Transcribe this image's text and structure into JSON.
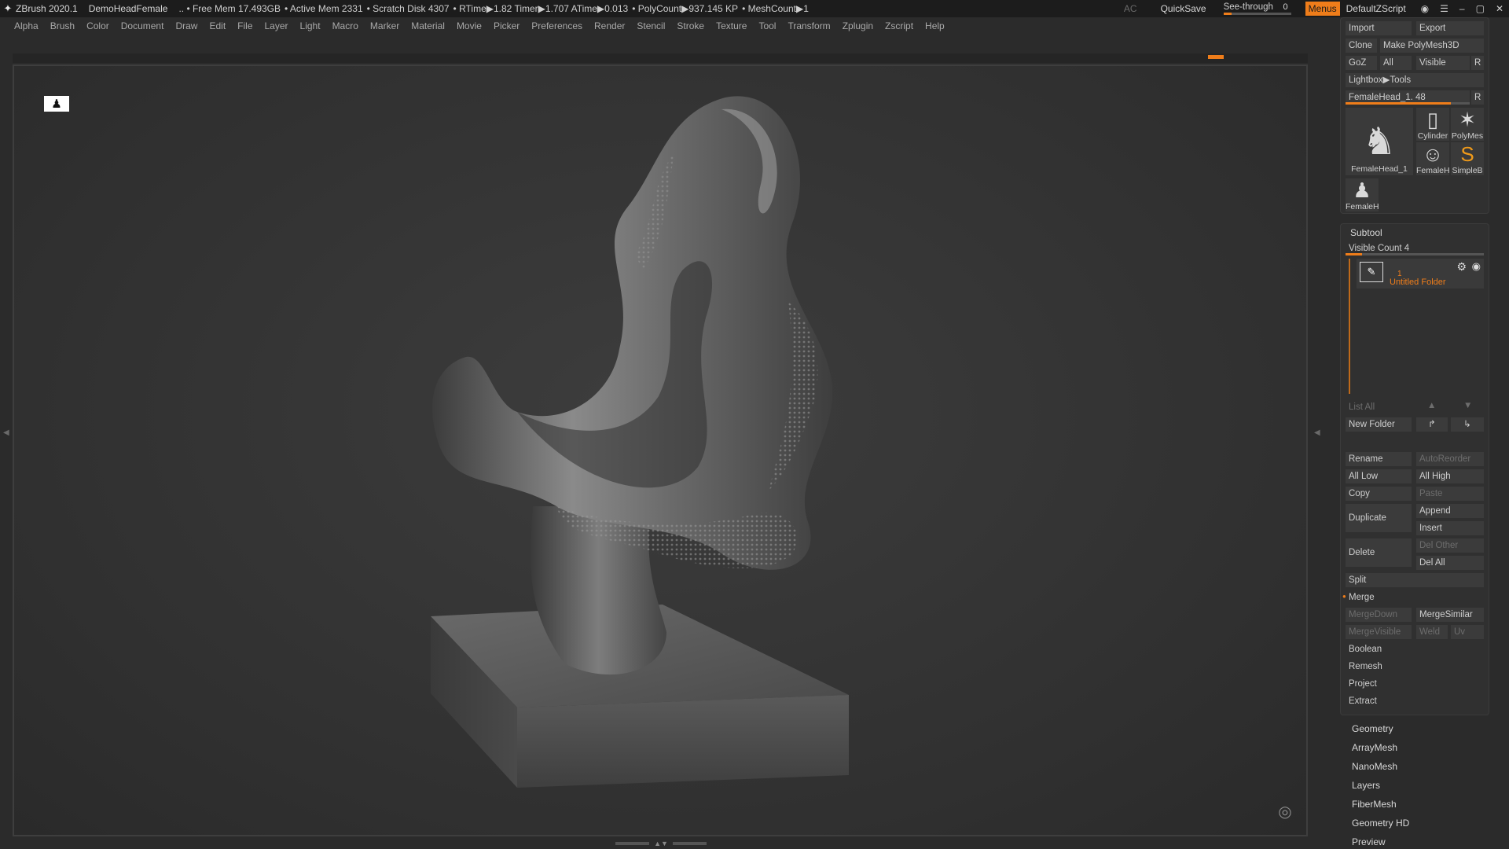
{
  "titlebar": {
    "app": "ZBrush 2020.1",
    "doc": "DemoHeadFemale",
    "stats": [
      ".. • Free Mem 17.493GB",
      "• Active Mem 2331",
      "• Scratch Disk 4307",
      "• RTime▶1.82 Timer▶1.707 ATime▶0.013",
      "• PolyCount▶937.145 KP",
      "• MeshCount▶1"
    ],
    "ac": "AC",
    "quicksave": "QuickSave",
    "see_through_label": "See-through",
    "see_through_value": "0",
    "see_through_fraction": 0.12,
    "menus": "Menus",
    "default_script": "DefaultZScript"
  },
  "menubar": [
    "Alpha",
    "Brush",
    "Color",
    "Document",
    "Draw",
    "Edit",
    "File",
    "Layer",
    "Light",
    "Macro",
    "Marker",
    "Material",
    "Movie",
    "Picker",
    "Preferences",
    "Render",
    "Stencil",
    "Stroke",
    "Texture",
    "Tool",
    "Transform",
    "Zplugin",
    "Zscript",
    "Help"
  ],
  "tool": {
    "import": "Import",
    "export": "Export",
    "clone": "Clone",
    "make_polymesh": "Make PolyMesh3D",
    "goz": "GoZ",
    "all": "All",
    "visible": "Visible",
    "r": "R",
    "lightbox_tools": "Lightbox▶Tools",
    "current_tool": "FemaleHead_1. 48",
    "current_tool_fraction": 0.85,
    "thumbs": {
      "main": "FemaleHead_1",
      "cylinder": "Cylinder",
      "polymesh": "PolyMes",
      "femalehead": "FemaleH",
      "simpleb": "SimpleB",
      "femaleh2": "FemaleH"
    }
  },
  "subtool": {
    "header": "Subtool",
    "visible_count": "Visible Count 4",
    "visible_count_fraction": 0.12,
    "folder_number": "1",
    "folder_name": "Untitled Folder",
    "list_all": "List All",
    "new_folder": "New Folder",
    "rename": "Rename",
    "autoreorder": "AutoReorder",
    "all_low": "All Low",
    "all_high": "All High",
    "copy": "Copy",
    "paste": "Paste",
    "duplicate": "Duplicate",
    "append": "Append",
    "insert": "Insert",
    "delete": "Delete",
    "del_other": "Del Other",
    "del_all": "Del All",
    "split": "Split",
    "merge": "Merge",
    "mergedown": "MergeDown",
    "mergesimilar": "MergeSimilar",
    "mergevisible": "MergeVisible",
    "weld": "Weld",
    "uv": "Uv",
    "boolean": "Boolean",
    "remesh": "Remesh",
    "project": "Project",
    "extract": "Extract"
  },
  "sections": [
    "Geometry",
    "ArrayMesh",
    "NanoMesh",
    "Layers",
    "FiberMesh",
    "Geometry HD",
    "Preview"
  ],
  "colors": {
    "accent": "#ef7d1a",
    "panel": "#303030",
    "button": "#3b3b3b",
    "viewport": "#353535"
  },
  "icons": {
    "zbrush_logo": "zbrush-logo-icon",
    "navigation": "figure-icon",
    "gizmo": "target-icon"
  }
}
